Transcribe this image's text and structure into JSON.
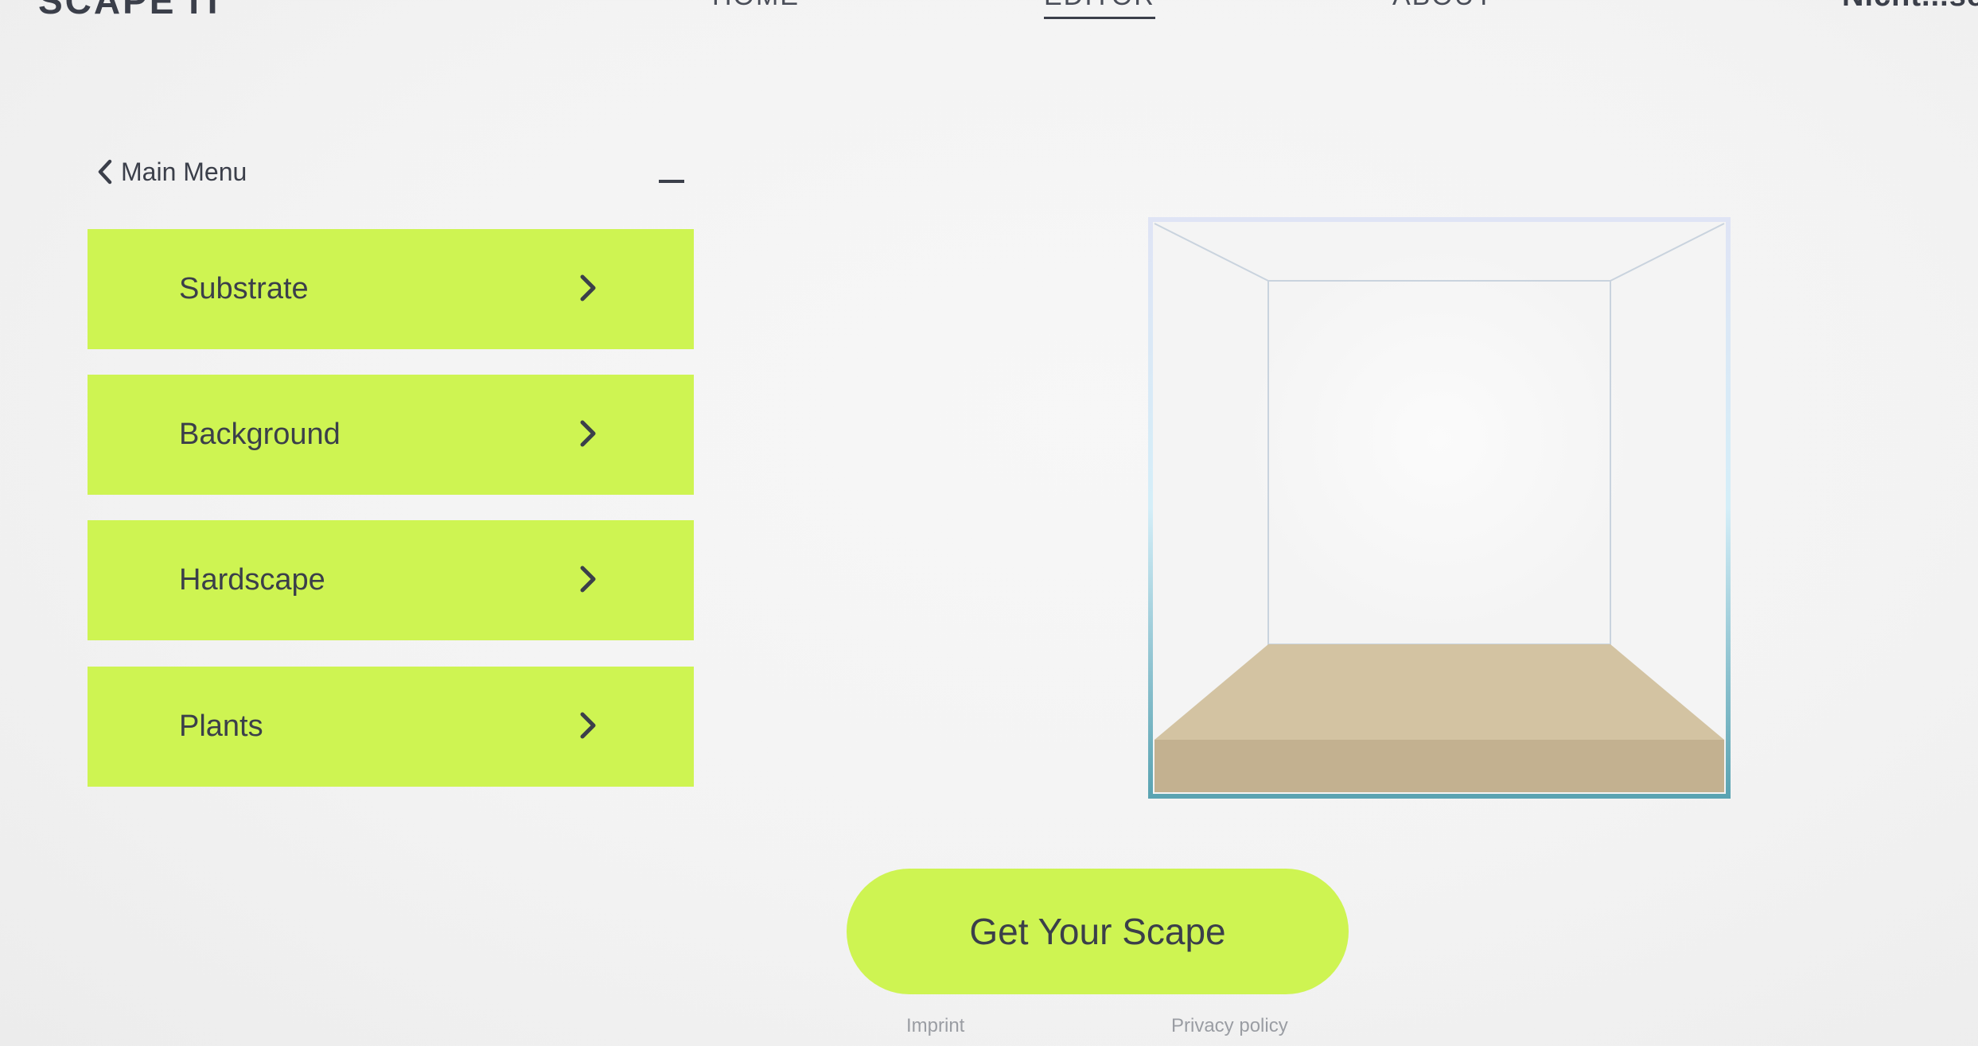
{
  "header": {
    "logo": "SCAPE IT",
    "nav": {
      "home": "HOME",
      "editor": "EDITOR",
      "about": "ABOUT"
    },
    "right_label": "Nicht...se"
  },
  "menu": {
    "back_label": "Main Menu",
    "items": [
      {
        "label": "Substrate"
      },
      {
        "label": "Background"
      },
      {
        "label": "Hardscape"
      },
      {
        "label": "Plants"
      }
    ]
  },
  "cta": {
    "label": "Get Your Scape"
  },
  "footer": {
    "imprint": "Imprint",
    "privacy": "Privacy policy"
  },
  "colors": {
    "accent": "#cef452",
    "text": "#3b3f4a",
    "sand_top": "#d3c3a2",
    "sand_front": "#c3b190",
    "glass_edge_top": "#dfe6f5",
    "glass_edge_bottom": "#5aa3b2"
  }
}
